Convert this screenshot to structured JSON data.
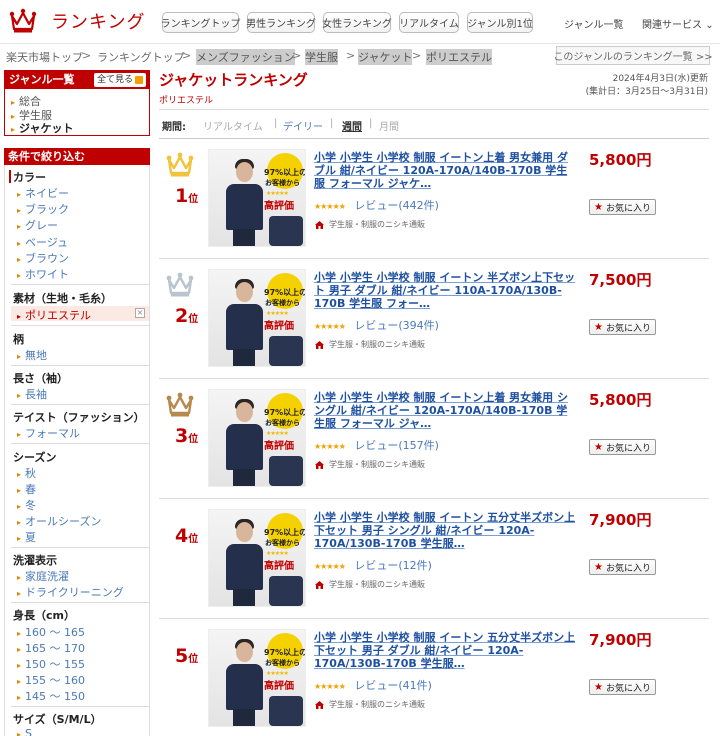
{
  "header": {
    "logo_text": "ランキング",
    "nav": [
      "ランキングトップ",
      "男性ランキング",
      "女性ランキング",
      "リアルタイム",
      "ジャンル別1位"
    ],
    "genre_list": "ジャンル一覧",
    "related": "関連サービス"
  },
  "breadcrumb": {
    "items": [
      "楽天市場トップ",
      "ランキングトップ",
      "メンズファッション",
      "学生服",
      "ジャケット",
      "ポリエステル"
    ],
    "separator": ">",
    "genre_link": "このジャンルのランキング一覧 >>"
  },
  "sidebar": {
    "genre_title": "ジャンル一覧",
    "show_all": "全て見る",
    "genres": [
      "総合",
      "学生服",
      "ジャケット"
    ],
    "filter_title": "条件で絞り込む",
    "color": {
      "title": "カラー",
      "items": [
        "ネイビー",
        "ブラック",
        "グレー",
        "ベージュ",
        "ブラウン",
        "ホワイト"
      ]
    },
    "material": {
      "title": "素材（生地・毛糸）",
      "selected": "ポリエステル",
      "clear": "×"
    },
    "pattern": {
      "title": "柄",
      "items": [
        "無地"
      ]
    },
    "sleeve": {
      "title": "長さ（袖）",
      "items": [
        "長袖"
      ]
    },
    "taste": {
      "title": "テイスト（ファッション）",
      "items": [
        "フォーマル"
      ]
    },
    "season": {
      "title": "シーズン",
      "items": [
        "秋",
        "春",
        "冬",
        "オールシーズン",
        "夏"
      ]
    },
    "wash": {
      "title": "洗濯表示",
      "items": [
        "家庭洗濯",
        "ドライクリーニング"
      ]
    },
    "height": {
      "title": "身長（cm）",
      "items": [
        "160 ～ 165",
        "165 ～ 170",
        "150 ～ 155",
        "155 ～ 160",
        "145 ～ 150"
      ]
    },
    "size": {
      "title": "サイズ（S/M/L）",
      "items": [
        "S"
      ]
    }
  },
  "main": {
    "title": "ジャケットランキング",
    "subtitle": "ポリエステル",
    "updated": "2024年4月3日(水)更新",
    "period_range": "(集計日：3月25日～3月31日)",
    "period_label": "期間:",
    "period_options": [
      "リアルタイム",
      "デイリー",
      "週間",
      "月間"
    ],
    "period_active": "週間",
    "fav_label": "お気に入り",
    "thumb": {
      "line1": "97%以上の",
      "line2": "お客様から",
      "stars": "★★★★★",
      "high": "高評価"
    }
  },
  "products": [
    {
      "rank": "1",
      "rank_suffix": "位",
      "medal": "gold",
      "title": "小学 小学生 小学校 制服 イートン上着 男女兼用 ダブル 紺/ネイビー 120A-170A/140B-170B 学生服 フォーマル ジャケ…",
      "stars": "★★★★★",
      "reviews": "レビュー(442件)",
      "shop": "学生服・制服のニシキ通販",
      "price": "5,800円"
    },
    {
      "rank": "2",
      "rank_suffix": "位",
      "medal": "silver",
      "title": "小学 小学生 小学校 制服 イートン 半ズボン上下セット 男子 ダブル 紺/ネイビー 110A-170A/130B-170B 学生服 フォー…",
      "stars": "★★★★★",
      "reviews": "レビュー(394件)",
      "shop": "学生服・制服のニシキ通販",
      "price": "7,500円"
    },
    {
      "rank": "3",
      "rank_suffix": "位",
      "medal": "bronze",
      "title": "小学 小学生 小学校 制服 イートン上着 男女兼用 シングル 紺/ネイビー 120A-170A/140B-170B 学生服 フォーマル ジャ…",
      "stars": "★★★★★",
      "reviews": "レビュー(157件)",
      "shop": "学生服・制服のニシキ通販",
      "price": "5,800円"
    },
    {
      "rank": "4",
      "rank_suffix": "位",
      "medal": "",
      "title": "小学 小学生 小学校 制服 イートン 五分丈半ズボン上下セット 男子 シングル 紺/ネイビー 120A-170A/130B-170B 学生服…",
      "stars": "★★★★★",
      "reviews": "レビュー(12件)",
      "shop": "学生服・制服のニシキ通販",
      "price": "7,900円"
    },
    {
      "rank": "5",
      "rank_suffix": "位",
      "medal": "",
      "title": "小学 小学生 小学校 制服 イートン 五分丈半ズボン上下セット 男子 ダブル 紺/ネイビー 120A-170A/130B-170B 学生服…",
      "stars": "★★★★★",
      "reviews": "レビュー(41件)",
      "shop": "学生服・制服のニシキ通販",
      "price": "7,900円"
    }
  ],
  "colors": {
    "brand": "#bf0000",
    "gold": "#f2c23a",
    "silver": "#b9c4cf",
    "bronze": "#b8894f",
    "link": "#1e50a0"
  }
}
